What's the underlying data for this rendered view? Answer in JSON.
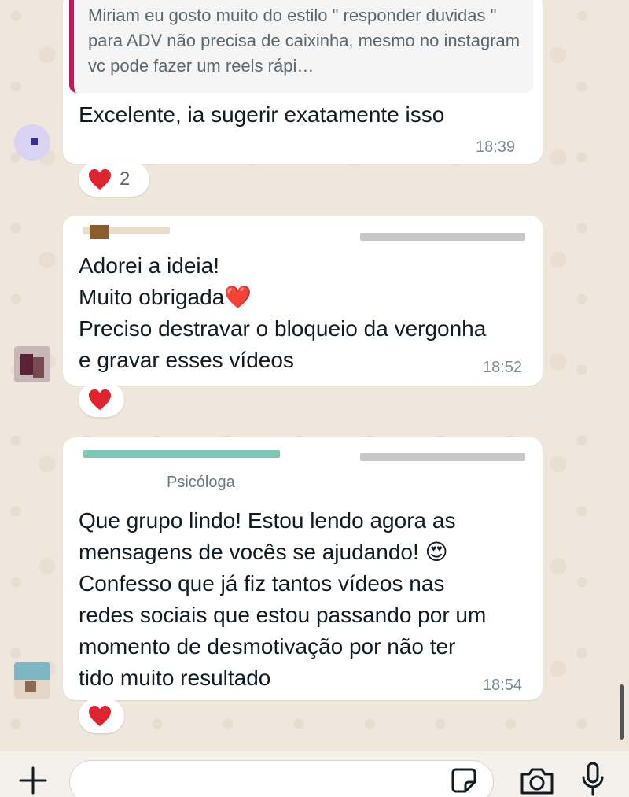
{
  "messages": [
    {
      "quoted_text": "Miriam eu gosto muito do estilo \" responder duvidas \" para ADV não precisa de caixinha, mesmo no instagram vc pode fazer um reels rápi…",
      "text": "Excelente, ia sugerir exatamente isso",
      "time": "18:39",
      "reaction_count": "2"
    },
    {
      "text": "Adorei a ideia!\nMuito obrigada❤️\nPreciso destravar o bloqueio da vergonha\ne gravar esses vídeos",
      "time": "18:52"
    },
    {
      "sender_role": "Psicóloga",
      "text": "Que grupo lindo! Estou lendo agora as\nmensagens de vocês se ajudando! 😍\nConfesso que já fiz tantos vídeos nas\nredes sociais que estou passando por um\nmomento de desmotivação por não ter\ntido muito resultado",
      "time": "18:54"
    }
  ],
  "icons": {
    "reaction": "red-heart-icon",
    "add": "plus-icon",
    "sticker": "sticker-icon",
    "camera": "camera-icon",
    "mic": "microphone-icon"
  },
  "colors": {
    "quote_bar": "#c2185b",
    "heart": "#e0242f",
    "bubble": "#ffffff",
    "background": "#efe6dc"
  }
}
